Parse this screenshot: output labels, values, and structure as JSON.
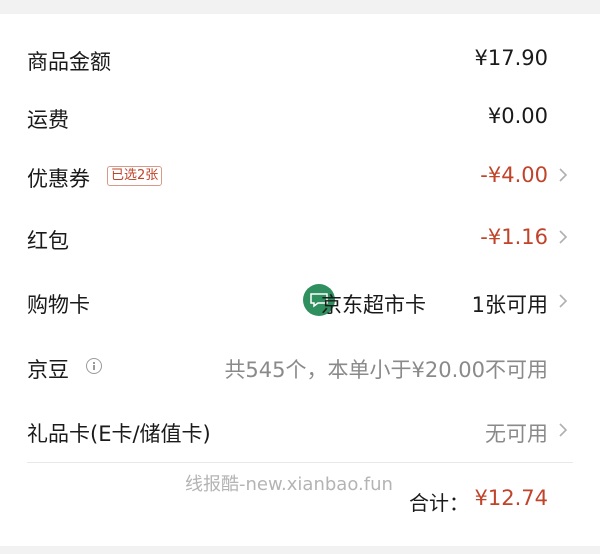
{
  "rows": {
    "goods": {
      "label": "商品金额",
      "value": "¥17.90"
    },
    "shipping": {
      "label": "运费",
      "value": "¥0.00"
    },
    "coupon": {
      "label": "优惠券",
      "tag": "已选2张",
      "value": "-¥4.00"
    },
    "redpacket": {
      "label": "红包",
      "value": "-¥1.16"
    },
    "shopping_card": {
      "label": "购物卡",
      "card_name": "京东超市卡",
      "card_count": "1张可用"
    },
    "jingdou": {
      "label": "京豆",
      "value": "共545个，本单小于¥20.00不可用"
    },
    "gift_card": {
      "label": "礼品卡(E卡/储值卡)",
      "value": "无可用"
    }
  },
  "watermark": "线报酷-new.xianbao.fun",
  "total": {
    "label": "合计：",
    "value": "¥12.74"
  },
  "colors": {
    "accent_red": "#c0432a",
    "card_icon_green": "#2f8f5e"
  },
  "icons": {
    "chevron": "chevron-right-icon",
    "info": "info-icon",
    "card": "card-icon"
  }
}
